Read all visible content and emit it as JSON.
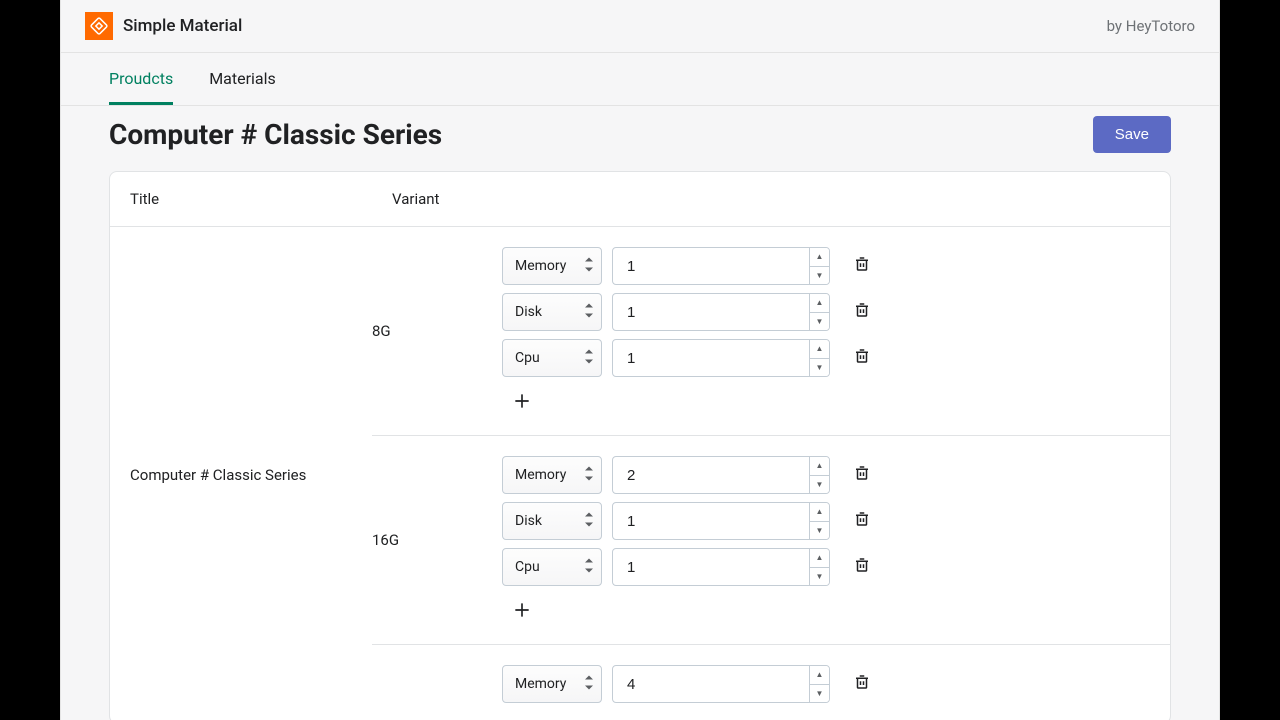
{
  "app": {
    "title": "Simple Material",
    "byline": "by HeyTotoro"
  },
  "tabs": {
    "items": [
      {
        "label": "Proudcts",
        "active": true
      },
      {
        "label": "Materials",
        "active": false
      }
    ]
  },
  "header": {
    "title": "Computer # Classic Series",
    "save_label": "Save"
  },
  "table": {
    "columns": {
      "title": "Title",
      "variant": "Variant"
    },
    "product_title": "Computer # Classic Series",
    "variants": [
      {
        "name": "8G",
        "materials": [
          {
            "type": "Memory",
            "qty": "1"
          },
          {
            "type": "Disk",
            "qty": "1"
          },
          {
            "type": "Cpu",
            "qty": "1"
          }
        ]
      },
      {
        "name": "16G",
        "materials": [
          {
            "type": "Memory",
            "qty": "2"
          },
          {
            "type": "Disk",
            "qty": "1"
          },
          {
            "type": "Cpu",
            "qty": "1"
          }
        ]
      },
      {
        "name": "",
        "materials": [
          {
            "type": "Memory",
            "qty": "4"
          }
        ]
      }
    ]
  }
}
